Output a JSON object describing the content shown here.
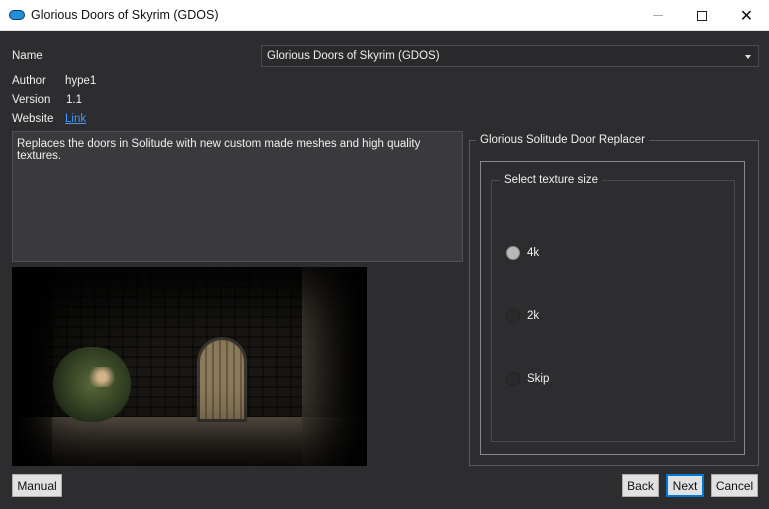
{
  "window": {
    "title": "Glorious Doors of Skyrim (GDOS)"
  },
  "info": {
    "name_label": "Name",
    "name_value": "Glorious Doors of Skyrim (GDOS)",
    "author_label": "Author",
    "author_value": "hype1",
    "version_label": "Version",
    "version_value": "1.1",
    "website_label": "Website",
    "website_link": "Link"
  },
  "description": "Replaces the doors in Solitude with new custom made meshes and high quality textures.",
  "options": {
    "group_title": "Glorious Solitude Door Replacer",
    "sub_title": "Select texture size",
    "choices": [
      {
        "label": "4k",
        "selected": true
      },
      {
        "label": "2k",
        "selected": false
      },
      {
        "label": "Skip",
        "selected": false
      }
    ]
  },
  "buttons": {
    "manual": "Manual",
    "back": "Back",
    "next": "Next",
    "cancel": "Cancel"
  },
  "colors": {
    "background": "#2d2d30",
    "link": "#3d9bff",
    "accent": "#0078d7"
  }
}
